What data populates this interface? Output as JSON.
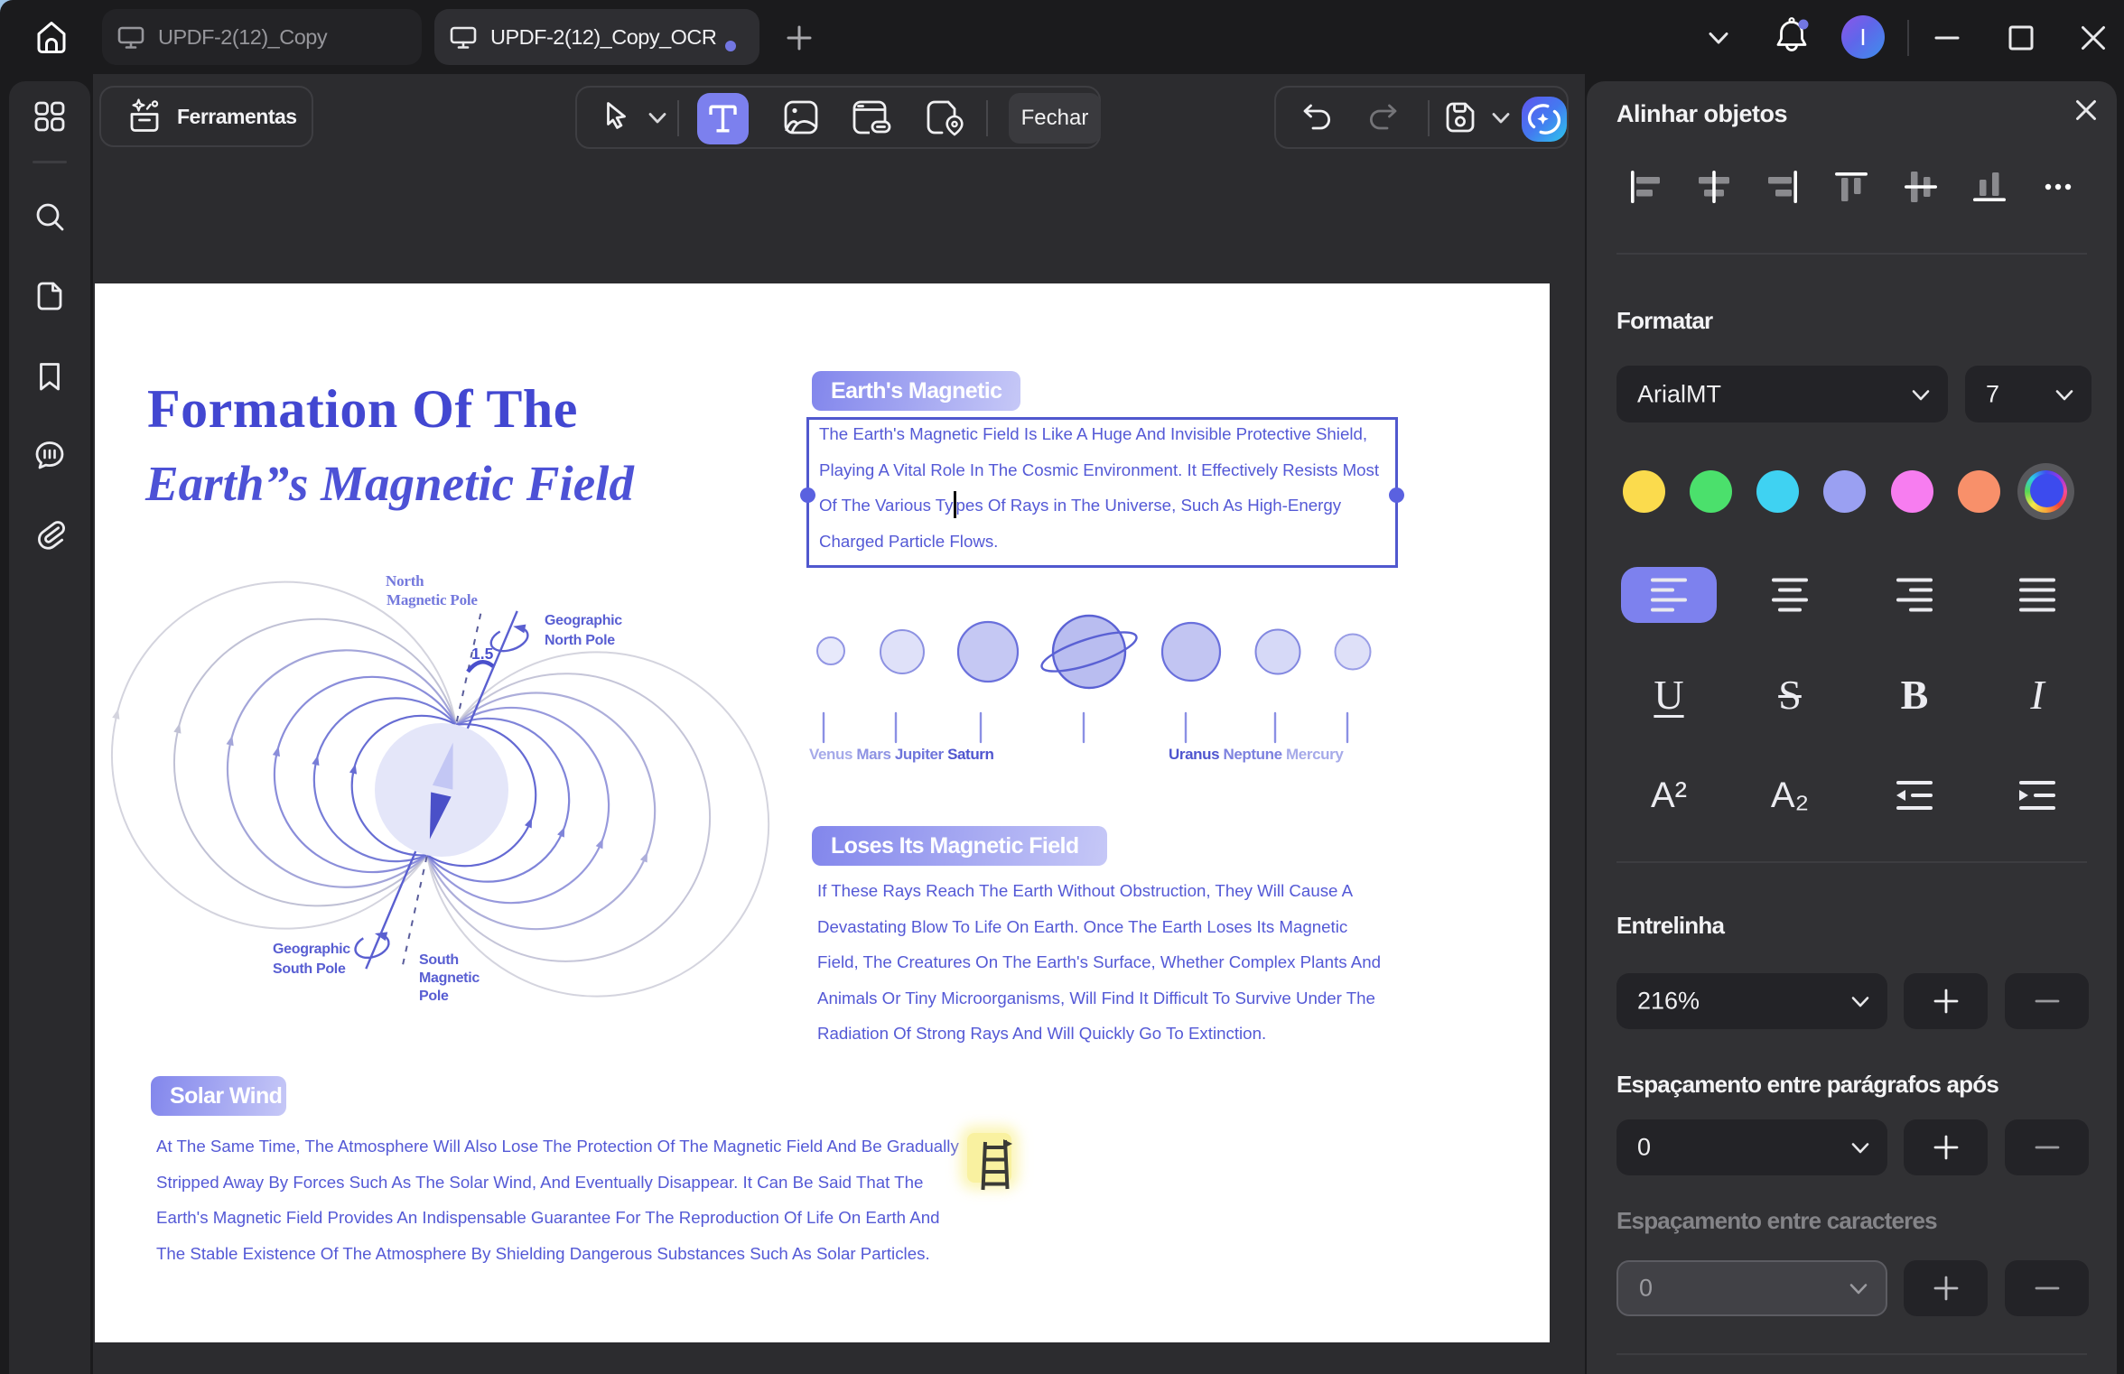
{
  "app": {
    "tabs": [
      {
        "label": "UPDF-2(12)_Copy"
      },
      {
        "label": "UPDF-2(12)_Copy_OCR"
      }
    ],
    "avatar_initial": "I"
  },
  "toolbar": {
    "tools_label": "Ferramentas",
    "close_label": "Fechar"
  },
  "panel": {
    "title": "Alinhar objetos",
    "format_heading": "Formatar",
    "font_name": "ArialMT",
    "font_size": "7",
    "colors": [
      "#fbdb4d",
      "#4be06c",
      "#3fd2f2",
      "#9aa0f2",
      "#f77df0",
      "#f8906a"
    ],
    "style_glyphs": {
      "underline": "U",
      "strikethrough": "S",
      "bold": "B",
      "italic": "I"
    },
    "script_glyphs": {
      "superscript": "A²",
      "subscript": "A₂"
    },
    "line_spacing_heading": "Entrelinha",
    "line_spacing_value": "216%",
    "para_spacing_heading": "Espaçamento entre parágrafos após",
    "para_spacing_value": "0",
    "char_spacing_heading": "Espaçamento entre caracteres",
    "char_spacing_value": "0"
  },
  "doc": {
    "title1": "Formation Of The",
    "title2": "Earth”s Magnetic Field",
    "badge1": "Earth's Magnetic",
    "badge2": "Loses Its Magnetic Field",
    "badge3": "Solar Wind",
    "textbox": {
      "l1": "The Earth's Magnetic Field Is Like A Huge And Invisible Protective Shield,",
      "l2": "Playing A Vital Role In The Cosmic Environment. It Effectively Resists Most",
      "l3a": "Of The Various Ty",
      "l3b": "pes Of Rays in The Universe, Such As High-Energy",
      "l4": "Charged Particle Flows."
    },
    "para2": {
      "l1": "If These Rays Reach The Earth Without Obstruction, They Will Cause A",
      "l2": "Devastating Blow To Life On Earth. Once The Earth Loses Its Magnetic",
      "l3": "Field, The Creatures On The Earth's Surface, Whether Complex Plants And",
      "l4": "Animals Or Tiny Microorganisms, Will Find It Difficult To Survive Under The",
      "l5": "Radiation Of Strong Rays And Will Quickly Go To Extinction."
    },
    "para3": {
      "l1": "At The Same Time, The Atmosphere Will Also Lose The Protection Of The Magnetic Field And Be Gradually",
      "l2": "Stripped Away By Forces Such As The Solar Wind, And Eventually Disappear. It Can Be Said That The",
      "l3": "Earth's Magnetic Field Provides An Indispensable Guarantee For The Reproduction Of Life On Earth And",
      "l4": "The Stable Existence Of The Atmosphere By Shielding Dangerous Substances Such As Solar Particles."
    },
    "diagram": {
      "north_1": "North",
      "north_2": "Magnetic Pole",
      "geo_north_1": "Geographic",
      "geo_north_2": "North Pole",
      "geo_south_1": "Geographic",
      "geo_south_2": "South Pole",
      "south_1": "South",
      "south_2": "Magnetic",
      "south_3": "Pole",
      "angle": "1.5"
    },
    "planets_left": [
      {
        "t": "Venus",
        "c": "#a6aae9"
      },
      {
        "t": "Mars",
        "c": "#8e93e3"
      },
      {
        "t": "Jupiter",
        "c": "#6f75db"
      },
      {
        "t": "Saturn",
        "c": "#5056cf"
      }
    ],
    "planets_right": [
      {
        "t": "Uranus",
        "c": "#4f55cf"
      },
      {
        "t": "Neptune",
        "c": "#7d82df"
      },
      {
        "t": "Mercury",
        "c": "#a6aae9"
      }
    ]
  }
}
